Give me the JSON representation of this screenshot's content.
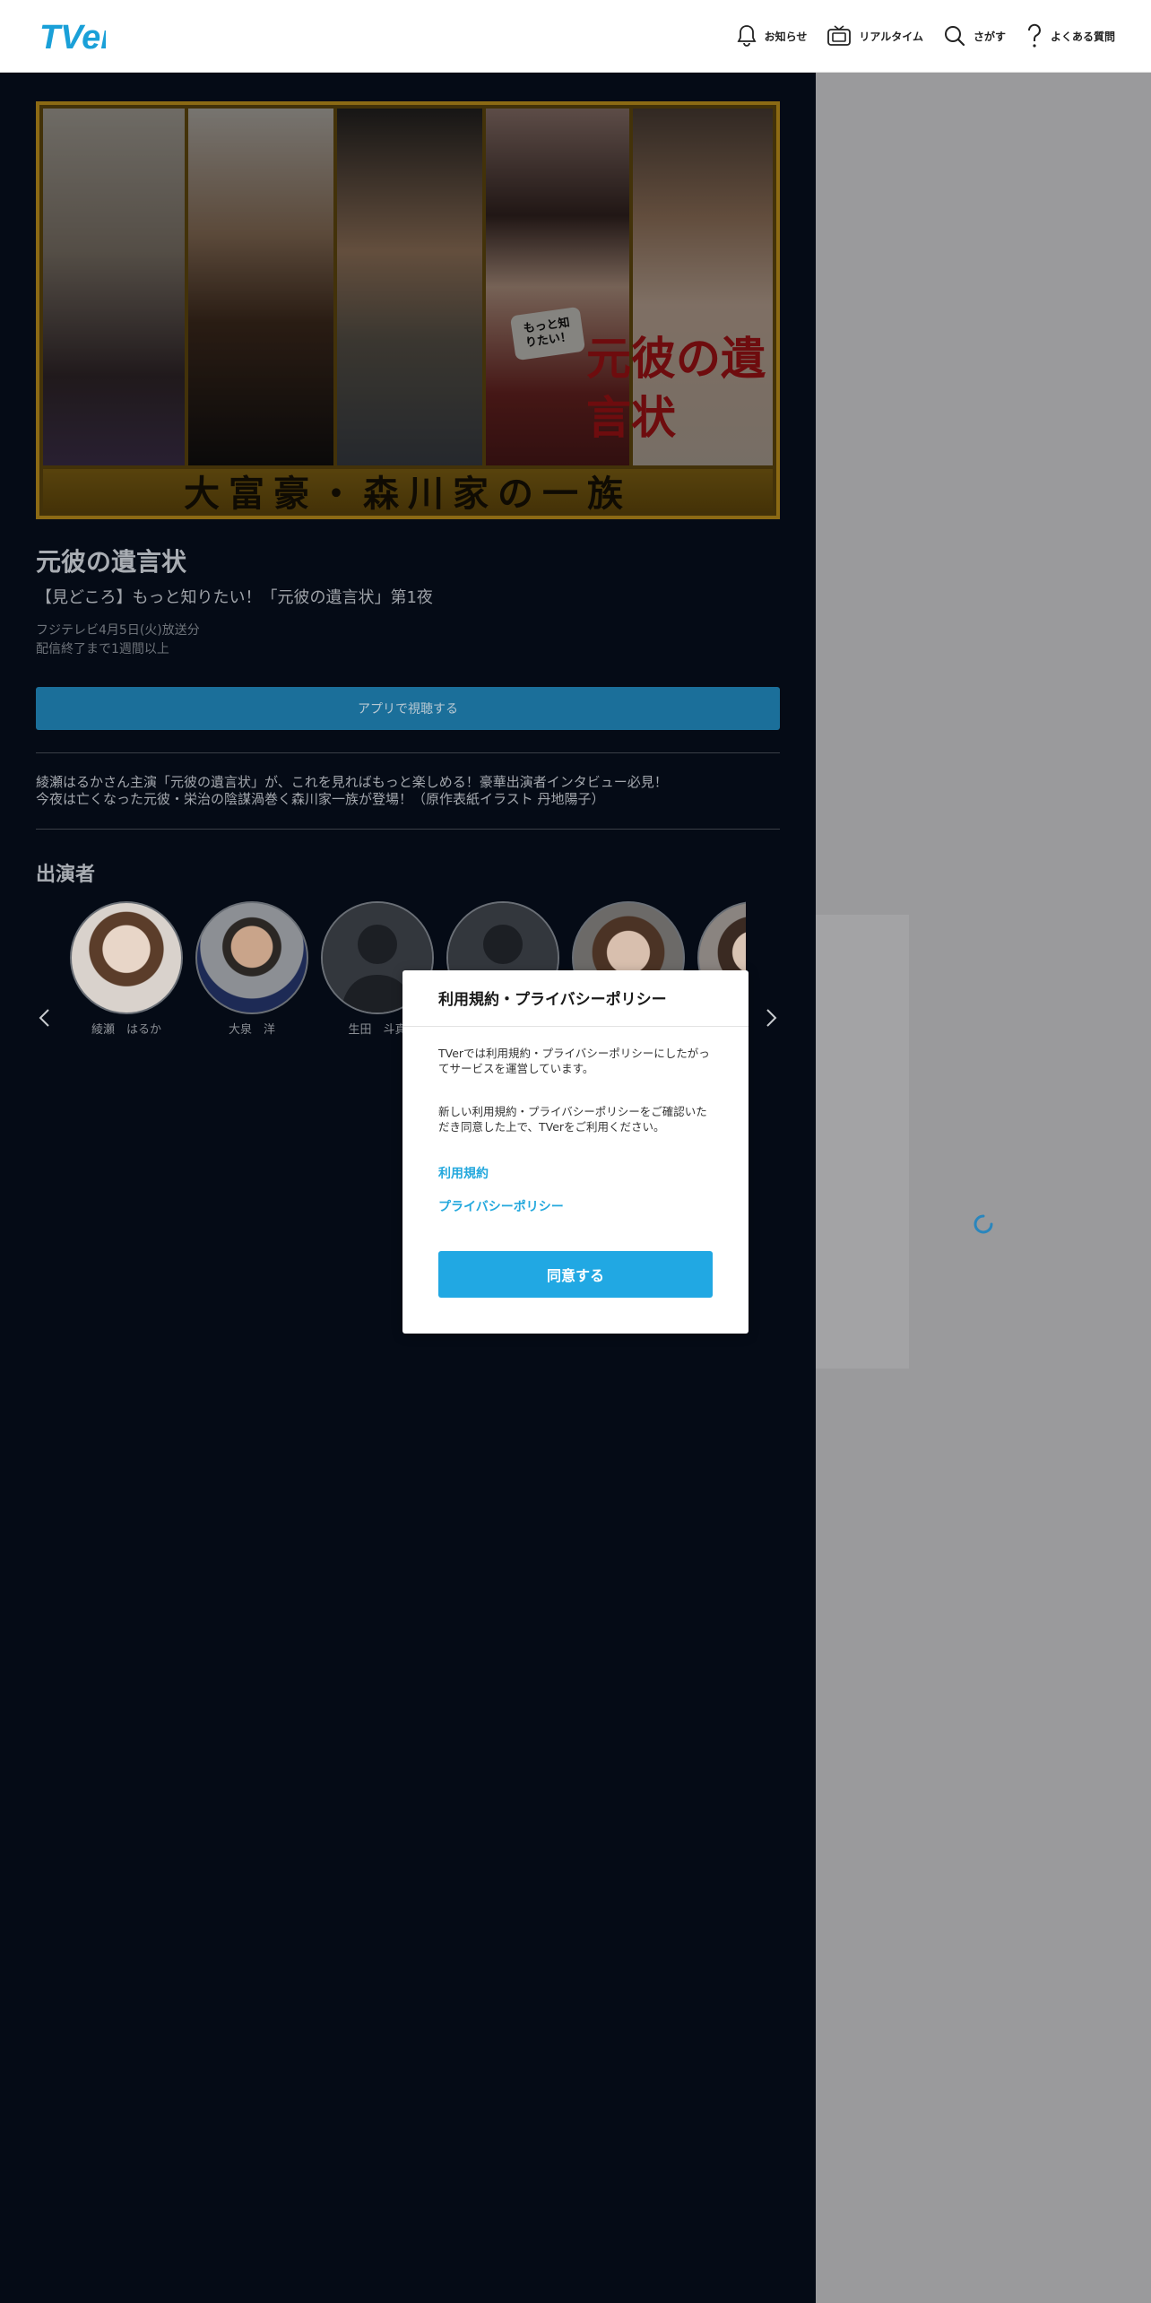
{
  "header": {
    "logo_text": "TVer",
    "nav": [
      {
        "label": "お知らせ",
        "icon": "bell-icon"
      },
      {
        "label": "リアルタイム",
        "icon": "tv-icon"
      },
      {
        "label": "さがす",
        "icon": "search-icon"
      },
      {
        "label": "よくある質問",
        "icon": "question-icon"
      }
    ]
  },
  "hero": {
    "banner_text": "大富豪・森川家の一族",
    "overlay_title": "元彼の遺言状",
    "overlay_badge": "もっと知りたい！"
  },
  "episode": {
    "title": "元彼の遺言状",
    "subtitle": "【見どころ】もっと知りたい！「元彼の遺言状」第1夜",
    "broadcast": "フジテレビ4月5日(火)放送分",
    "availability": "配信終了まで1週間以上",
    "app_button": "アプリで視聴する",
    "description": [
      "綾瀬はるかさん主演「元彼の遺言状」が、これを見ればもっと楽しめる！豪華出演者インタビュー必見！",
      "今夜は亡くなった元彼・栄治の陰謀渦巻く森川家一族が登場！（原作表紙イラスト 丹地陽子）"
    ]
  },
  "cast": {
    "heading": "出演者",
    "members": [
      {
        "name": "綾瀬　はるか"
      },
      {
        "name": "大泉　洋"
      },
      {
        "name": "生田　斗真"
      },
      {
        "name": ""
      },
      {
        "name": ""
      },
      {
        "name": ""
      }
    ]
  },
  "modal": {
    "title": "利用規約・プライバシーポリシー",
    "paragraph1": "TVerでは利用規約・プライバシーポリシーにしたがってサービスを運営しています。",
    "paragraph2": "新しい利用規約・プライバシーポリシーをご確認いただき同意した上で、TVerをご利用ください。",
    "link_terms": "利用規約",
    "link_privacy": "プライバシーポリシー",
    "agree_button": "同意する"
  },
  "colors": {
    "accent": "#21a8e3",
    "main_background": "#050b16",
    "overlay": "#9a9a9c"
  }
}
